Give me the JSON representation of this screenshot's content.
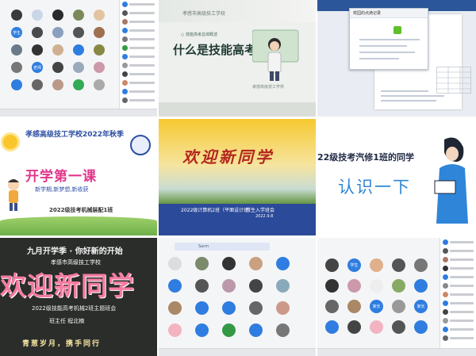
{
  "tile2": {
    "school": "孝感市高级技工学校",
    "bullet": "○ 技能高考总体概述",
    "title": "什么是技能高考",
    "footer": "孝感高级技工学校"
  },
  "tile3": {
    "panel_title": "校园的点滴记录"
  },
  "tile4": {
    "school": "孝感高级技工学校2022年秋季",
    "title": "开学第一课",
    "subtitle": "新学期,新梦想,新收获",
    "class_name": "2022级技考机械装配1班"
  },
  "tile5": {
    "title": "欢迎新同学",
    "caption_left": "2022级计算机2班（平面设计班）",
    "caption_right": "新生入学班会",
    "caption_date": "2022.9.8"
  },
  "tile6": {
    "line1": "22级技考汽修1班的同学",
    "line2": "认识一下"
  },
  "tile7": {
    "top": "九月开学季 · 你好新的开始",
    "school": "孝感市高级技工学校",
    "big": "欢迎新同学",
    "theme": "2022级技能高考机械2班主题班会",
    "teacher": "班主任 程北楠",
    "motto": "青葱岁月，携手同行"
  },
  "tile8": {
    "search_label": "Sarm"
  },
  "tile1": {
    "text_avatars": [
      "学生",
      "老师"
    ]
  },
  "tile9": {
    "text_avatars": [
      "学生",
      "家长",
      "家长"
    ]
  },
  "colors": {
    "blue_avatar": "#2f7de0",
    "pink_title": "#e0368b",
    "red_title": "#b3261e",
    "light_blue": "#2f86d8"
  }
}
